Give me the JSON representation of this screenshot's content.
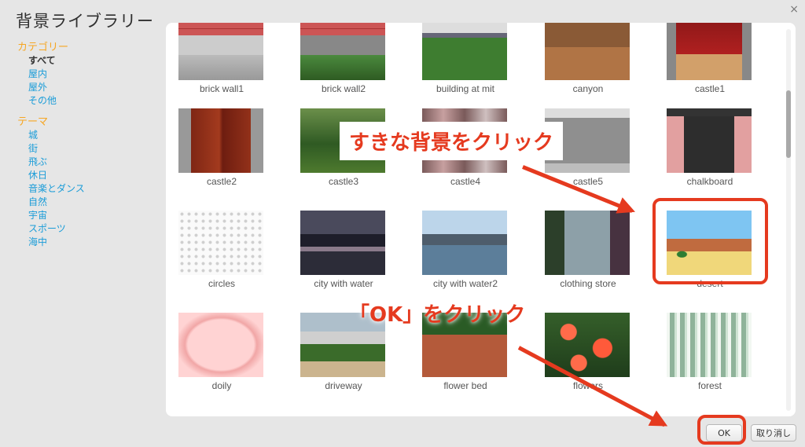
{
  "dialog": {
    "title": "背景ライブラリー",
    "close_symbol": "×"
  },
  "sidebar": {
    "category_heading": "カテゴリー",
    "categories": [
      "すべて",
      "屋内",
      "屋外",
      "その他"
    ],
    "theme_heading": "テーマ",
    "themes": [
      "城",
      "街",
      "飛ぶ",
      "休日",
      "音楽とダンス",
      "自然",
      "宇宙",
      "スポーツ",
      "海中"
    ]
  },
  "backdrops": [
    "brick wall1",
    "brick wall2",
    "building at mit",
    "canyon",
    "castle1",
    "castle2",
    "castle3",
    "castle4",
    "castle5",
    "chalkboard",
    "circles",
    "city with water",
    "city with water2",
    "clothing store",
    "desert",
    "doily",
    "driveway",
    "flower bed",
    "flowers",
    "forest"
  ],
  "annotations": {
    "pick_backdrop": "すきな背景をクリック",
    "click_ok": "「OK」をクリック"
  },
  "buttons": {
    "ok": "OK",
    "cancel": "取り消し"
  },
  "colors": {
    "accent_orange": "#f6a623",
    "link_blue": "#1a9cd8",
    "annotation_red": "#e53a1f"
  }
}
